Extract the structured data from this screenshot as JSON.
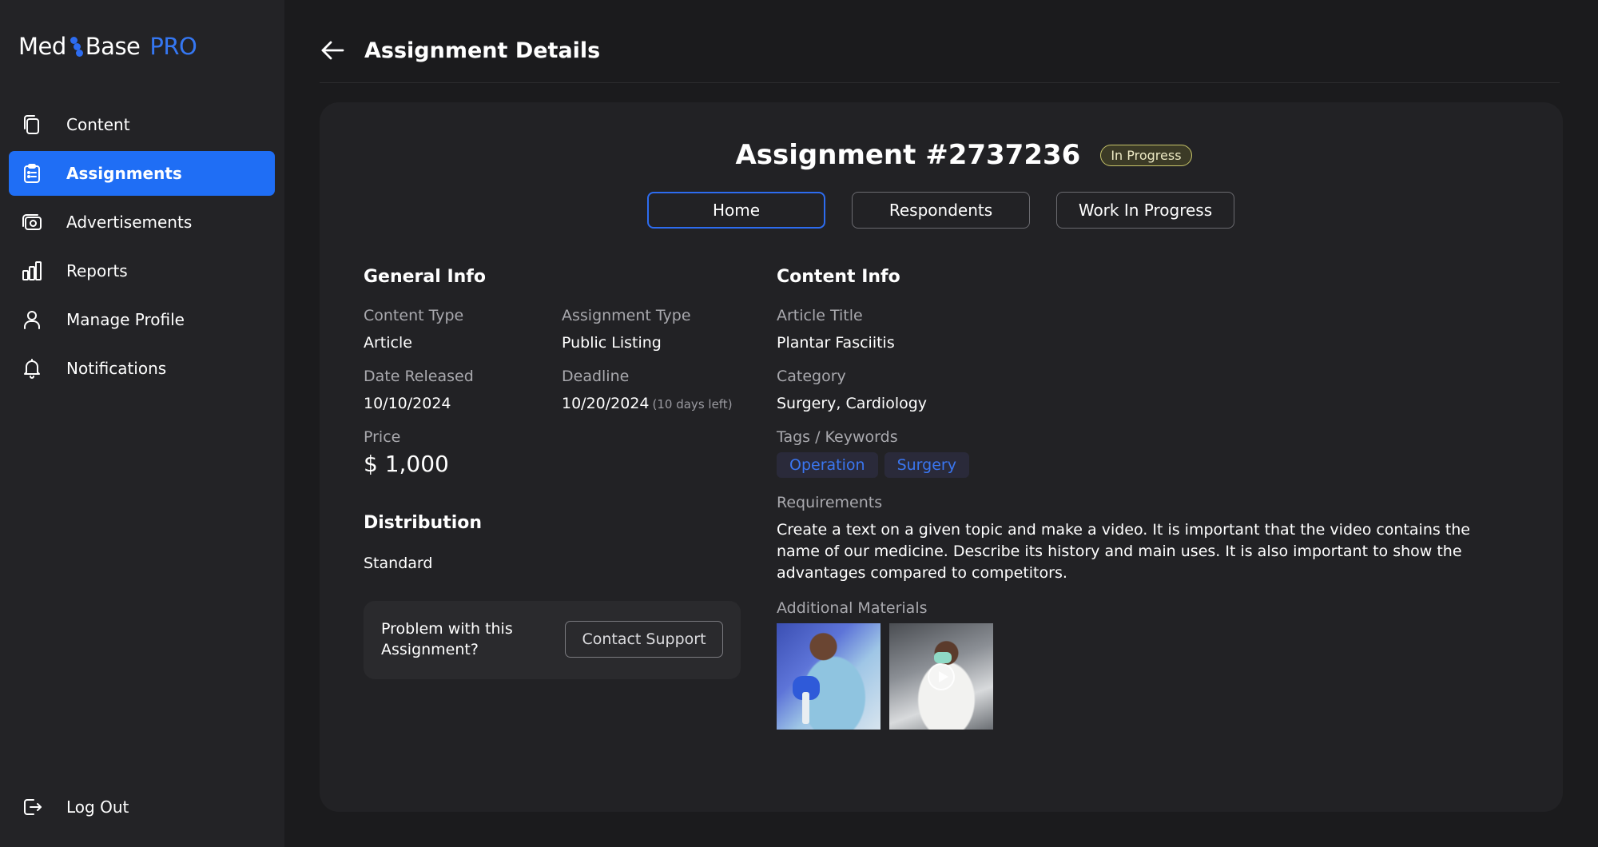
{
  "brand": {
    "part1": "Med",
    "part2": "Base",
    "suffix": "PRO",
    "accent": "#1f6ef5"
  },
  "sidebar": {
    "items": [
      {
        "label": "Content",
        "icon": "copy-icon",
        "active": false
      },
      {
        "label": "Assignments",
        "icon": "clipboard-icon",
        "active": true
      },
      {
        "label": "Advertisements",
        "icon": "camera-icon",
        "active": false
      },
      {
        "label": "Reports",
        "icon": "bar-chart-icon",
        "active": false
      },
      {
        "label": "Manage Profile",
        "icon": "user-icon",
        "active": false
      },
      {
        "label": "Notifications",
        "icon": "bell-icon",
        "active": false
      }
    ],
    "logout": {
      "label": "Log Out",
      "icon": "logout-icon"
    }
  },
  "header": {
    "title": "Assignment Details"
  },
  "assignment": {
    "title": "Assignment #2737236",
    "status": "In Progress",
    "tabs": [
      {
        "label": "Home",
        "active": true
      },
      {
        "label": "Respondents",
        "active": false
      },
      {
        "label": "Work In Progress",
        "active": false
      }
    ]
  },
  "general_info": {
    "title": "General Info",
    "content_type": {
      "label": "Content Type",
      "value": "Article"
    },
    "assignment_type": {
      "label": "Assignment Type",
      "value": "Public Listing"
    },
    "date_released": {
      "label": "Date Released",
      "value": "10/10/2024"
    },
    "deadline": {
      "label": "Deadline",
      "value": "10/20/2024",
      "note": "(10 days left)"
    },
    "price": {
      "label": "Price",
      "value": "$ 1,000"
    }
  },
  "distribution": {
    "title": "Distribution",
    "value": "Standard"
  },
  "support": {
    "text": "Problem with this Assignment?",
    "button": "Contact Support"
  },
  "content_info": {
    "title": "Content Info",
    "article_title": {
      "label": "Article Title",
      "value": "Plantar Fasciitis"
    },
    "category": {
      "label": "Category",
      "value": "Surgery, Cardiology"
    },
    "tags": {
      "label": "Tags / Keywords",
      "items": [
        "Operation",
        "Surgery"
      ]
    },
    "requirements": {
      "label": "Requirements",
      "value": "Create a text on a given topic and make a video. It is important that the video contains the name of our medicine. Describe its history and main uses. It is also important to show the advantages compared to competitors."
    },
    "materials": {
      "label": "Additional Materials"
    }
  }
}
